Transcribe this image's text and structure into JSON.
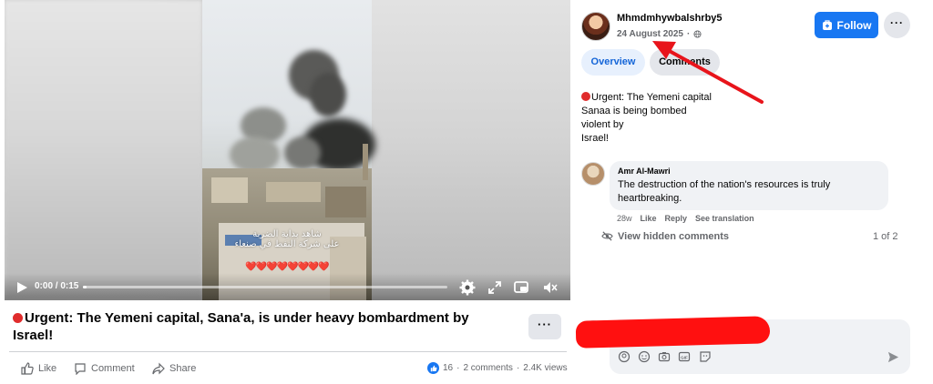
{
  "video": {
    "time_label": "0:00 / 0:15",
    "progress_fraction": 0.01,
    "watermark_line1": "شاهد بداية الضربة",
    "watermark_line2": "على شركة النفط في صنعاء",
    "hearts": "❤️❤️❤️❤️❤️❤️❤️❤️"
  },
  "post": {
    "title": "Urgent: The Yemeni capital, Sana'a, is under heavy bombardment by Israel!",
    "more_label": "···"
  },
  "actions": {
    "like_label": "Like",
    "comment_label": "Comment",
    "share_label": "Share"
  },
  "stats": {
    "reactions": "16",
    "separator1": "·",
    "comments": "2 comments",
    "separator2": "·",
    "views": "2.4K views"
  },
  "sidebar": {
    "author": "Mhmdmhywbalshrby5",
    "date": "24 August 2025",
    "separator": "·",
    "follow_label": "Follow",
    "more_label": "···",
    "tabs": [
      {
        "label": "Overview"
      },
      {
        "label": "Comments"
      }
    ],
    "body_lines": [
      "Urgent: The Yemeni capital",
      "Sanaa is being bombed",
      "violent by",
      "Israel!"
    ]
  },
  "comment": {
    "author": "Amr Al-Mawri",
    "text": "The destruction of the nation's resources is truly heartbreaking.",
    "age": "28w",
    "like_label": "Like",
    "reply_label": "Reply",
    "translate_label": "See translation"
  },
  "hidden": {
    "label": "View hidden comments",
    "pager": "1 of 2"
  },
  "colors": {
    "accent": "#1877f2",
    "redaction": "#ff1010",
    "arrow": "#e8141b"
  }
}
